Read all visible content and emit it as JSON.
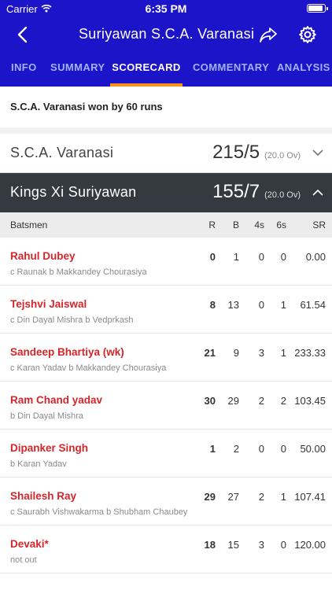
{
  "status": {
    "carrier": "Carrier",
    "time": "6:35 PM"
  },
  "nav": {
    "title": "Suriyawan   S.C.A. Varanasi"
  },
  "tabs": [
    {
      "label": "INFO"
    },
    {
      "label": "SUMMARY"
    },
    {
      "label": "SCORECARD"
    },
    {
      "label": "COMMENTARY"
    },
    {
      "label": "ANALYSIS"
    }
  ],
  "result": "S.C.A. Varanasi won by 60 runs",
  "innings": [
    {
      "team": "S.C.A. Varanasi",
      "score": "215/5",
      "overs": "(20.0 Ov)"
    },
    {
      "team": "Kings Xi Suriyawan",
      "score": "155/7",
      "overs": "(20.0 Ov)"
    }
  ],
  "batting_header": {
    "name": "Batsmen",
    "r": "R",
    "b": "B",
    "fours": "4s",
    "sixes": "6s",
    "sr": "SR"
  },
  "batsmen": [
    {
      "name": "Rahul Dubey",
      "dismissal": "c Raunak b Makkandey Chourasiya",
      "r": "0",
      "b": "1",
      "fours": "0",
      "sixes": "0",
      "sr": "0.00"
    },
    {
      "name": "Tejshvi Jaiswal",
      "dismissal": "c Din Dayal Mishra b Vedprkash",
      "r": "8",
      "b": "13",
      "fours": "0",
      "sixes": "1",
      "sr": "61.54"
    },
    {
      "name": "Sandeep Bhartiya (wk)",
      "dismissal": "c Karan Yadav b Makkandey Chourasiya",
      "r": "21",
      "b": "9",
      "fours": "3",
      "sixes": "1",
      "sr": "233.33"
    },
    {
      "name": "Ram Chand yadav",
      "dismissal": "b Din Dayal Mishra",
      "r": "30",
      "b": "29",
      "fours": "2",
      "sixes": "2",
      "sr": "103.45"
    },
    {
      "name": "Dipanker Singh",
      "dismissal": "b Karan Yadav",
      "r": "1",
      "b": "2",
      "fours": "0",
      "sixes": "0",
      "sr": "50.00"
    },
    {
      "name": "Shailesh Ray",
      "dismissal": "c Saurabh Vishwakarma b Shubham Chaubey",
      "r": "29",
      "b": "27",
      "fours": "2",
      "sixes": "1",
      "sr": "107.41"
    },
    {
      "name": "Devaki*",
      "dismissal": "not out",
      "r": "18",
      "b": "15",
      "fours": "3",
      "sixes": "0",
      "sr": "120.00"
    }
  ],
  "colors": {
    "header_bg": "#1b14c9",
    "active_tab_underline": "#f7931e",
    "batsman_name": "#d6252a",
    "innings_active_bg": "#343a40"
  },
  "icons": [
    "wifi-icon",
    "battery-icon",
    "back-arrow-icon",
    "share-icon",
    "gear-icon",
    "chevron-down-icon",
    "chevron-up-icon"
  ]
}
